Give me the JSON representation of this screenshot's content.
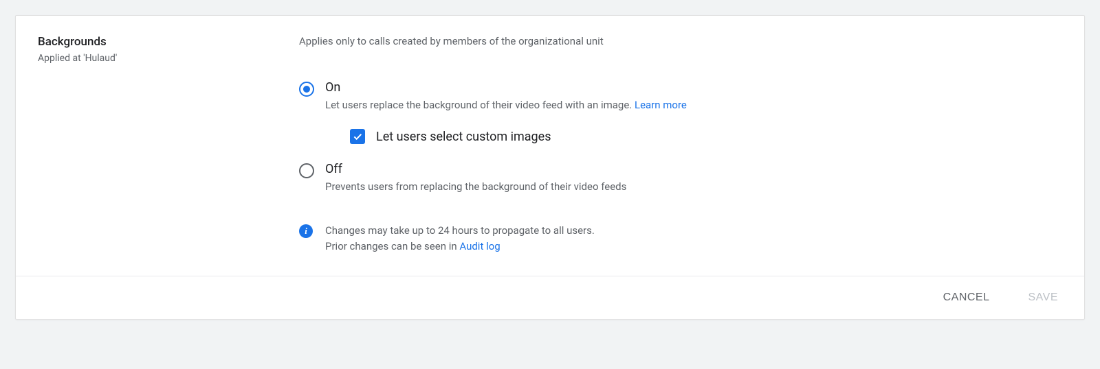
{
  "section": {
    "title": "Backgrounds",
    "applied_at": "Applied at 'Hulaud'",
    "description": "Applies only to calls created by members of the organizational unit"
  },
  "options": {
    "on": {
      "label": "On",
      "description_prefix": "Let users replace the background of their video feed with an image. ",
      "learn_more": "Learn more",
      "sub_checkbox_label": "Let users select custom images"
    },
    "off": {
      "label": "Off",
      "description": "Prevents users from replacing the background of their video feeds"
    }
  },
  "info": {
    "line1": "Changes may take up to 24 hours to propagate to all users.",
    "line2_prefix": "Prior changes can be seen in ",
    "audit_link": "Audit log"
  },
  "footer": {
    "cancel": "CANCEL",
    "save": "SAVE"
  }
}
